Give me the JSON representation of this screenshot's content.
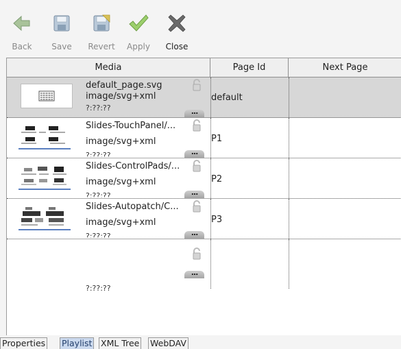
{
  "toolbar": {
    "back": "Back",
    "save": "Save",
    "revert": "Revert",
    "apply": "Apply",
    "close": "Close",
    "icons": {
      "back": "arrow-left-icon",
      "save": "floppy-disk-icon",
      "revert": "revert-icon",
      "apply": "checkmark-icon",
      "close": "close-x-icon"
    }
  },
  "grid": {
    "columns": [
      "Media",
      "Page Id",
      "Next Page"
    ],
    "rows": [
      {
        "name": "default_page.svg",
        "type": "image/svg+xml",
        "time": "?:??:??",
        "page_id": "default",
        "next_page": ""
      },
      {
        "name": "Slides-TouchPanel/...",
        "type": "image/svg+xml",
        "time": "?:??:??",
        "page_id": "P1",
        "next_page": ""
      },
      {
        "name": "Slides-ControlPads/...",
        "type": "image/svg+xml",
        "time": "?:??:??",
        "page_id": "P2",
        "next_page": ""
      },
      {
        "name": "Slides-Autopatch/C...",
        "type": "image/svg+xml",
        "time": "?:??:??",
        "page_id": "P3",
        "next_page": ""
      },
      {
        "name": "",
        "type": "",
        "time": "?:??:??",
        "page_id": "",
        "next_page": ""
      }
    ],
    "more_label": "..."
  },
  "tabs": [
    "Properties",
    "Playlist",
    "XML Tree",
    "WebDAV"
  ],
  "active_tab": "Playlist",
  "colors": {
    "selected_row": "#d7d7d7",
    "active_tab": "#cbd9ee",
    "apply_check": "#7fb34a",
    "back_arrow": "#9fb98a"
  }
}
